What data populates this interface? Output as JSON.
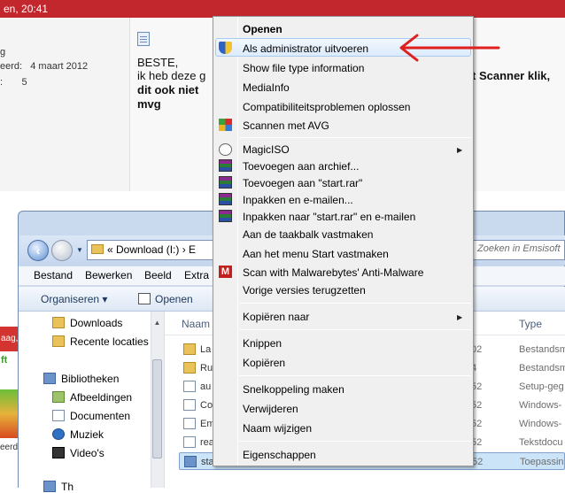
{
  "forum": {
    "header_time": "en, 20:41",
    "user_lines": [
      "g",
      "eerd:   4 maart 2012",
      ":       5"
    ],
    "post_line1": "BESTE,",
    "post_line2": "ik heb deze g",
    "post_line2_right": "t Scanner klik,",
    "post_line3": "dit ook niet",
    "post_line4": "mvg"
  },
  "left_strip": {
    "badge": "aag,",
    "green_text": "ft",
    "text": "eerd"
  },
  "explorer": {
    "address": "«  Download (I:)  ›  E",
    "search_placeholder": "Zoeken in Emsisoft",
    "menu": [
      "Bestand",
      "Bewerken",
      "Beeld",
      "Extra"
    ],
    "toolbar": {
      "organize": "Organiseren ▾",
      "open": "Openen"
    },
    "nav_items": [
      {
        "label": "Downloads",
        "icon": "folder-icon"
      },
      {
        "label": "Recente locaties",
        "icon": "folder-icon"
      },
      {
        "label": "Bibliotheken",
        "icon": "library-icon"
      },
      {
        "label": "Afbeeldingen",
        "icon": "pictures-icon"
      },
      {
        "label": "Documenten",
        "icon": "documents-icon"
      },
      {
        "label": "Muziek",
        "icon": "music-icon"
      },
      {
        "label": "Video's",
        "icon": "video-icon"
      },
      {
        "label": "Th",
        "icon": "library-icon"
      }
    ],
    "columns": {
      "name": "Naam",
      "type": "Type"
    },
    "files": [
      {
        "name": "La",
        "date": "02",
        "type": "Bestandsm",
        "icon": "folder-icon"
      },
      {
        "name": "Ru",
        "date": "4",
        "type": "Bestandsm",
        "icon": "folder-icon"
      },
      {
        "name": "au",
        "date": "52",
        "type": "Setup-geg",
        "icon": "setup-icon"
      },
      {
        "name": "Co",
        "date": "52",
        "type": "Windows-",
        "icon": "script-icon"
      },
      {
        "name": "Em",
        "date": "52",
        "type": "Windows-",
        "icon": "script-icon"
      },
      {
        "name": "rea",
        "date": "52",
        "type": "Tekstdocu",
        "icon": "text-file-icon"
      },
      {
        "name": "sta",
        "date": "52",
        "type": "Toepassin",
        "icon": "application-icon",
        "selected": true
      }
    ]
  },
  "context_menu": {
    "items": {
      "open": "Openen",
      "run_admin": "Als administrator uitvoeren",
      "show_type": "Show file type information",
      "mediainfo": "MediaInfo",
      "compat": "Compatibiliteitsproblemen oplossen",
      "avg": "Scannen met AVG",
      "magiciso": "MagicISO",
      "add_archive": "Toevoegen aan archief...",
      "add_rar": "Toevoegen aan \"start.rar\"",
      "pack_email": "Inpakken en e-mailen...",
      "pack_rar_email": "Inpakken naar \"start.rar\" en e-mailen",
      "pin_taskbar": "Aan de taakbalk vastmaken",
      "pin_start": "Aan het menu Start vastmaken",
      "malwarebytes": "Scan with Malwarebytes' Anti-Malware",
      "restore": "Vorige versies terugzetten",
      "copy_to": "Kopiëren naar",
      "cut": "Knippen",
      "copy": "Kopiëren",
      "shortcut": "Snelkoppeling maken",
      "delete": "Verwijderen",
      "rename": "Naam wijzigen",
      "properties": "Eigenschappen"
    },
    "highlight_color": "#dcebfc",
    "annotation_arrow_color": "#e0201f"
  }
}
